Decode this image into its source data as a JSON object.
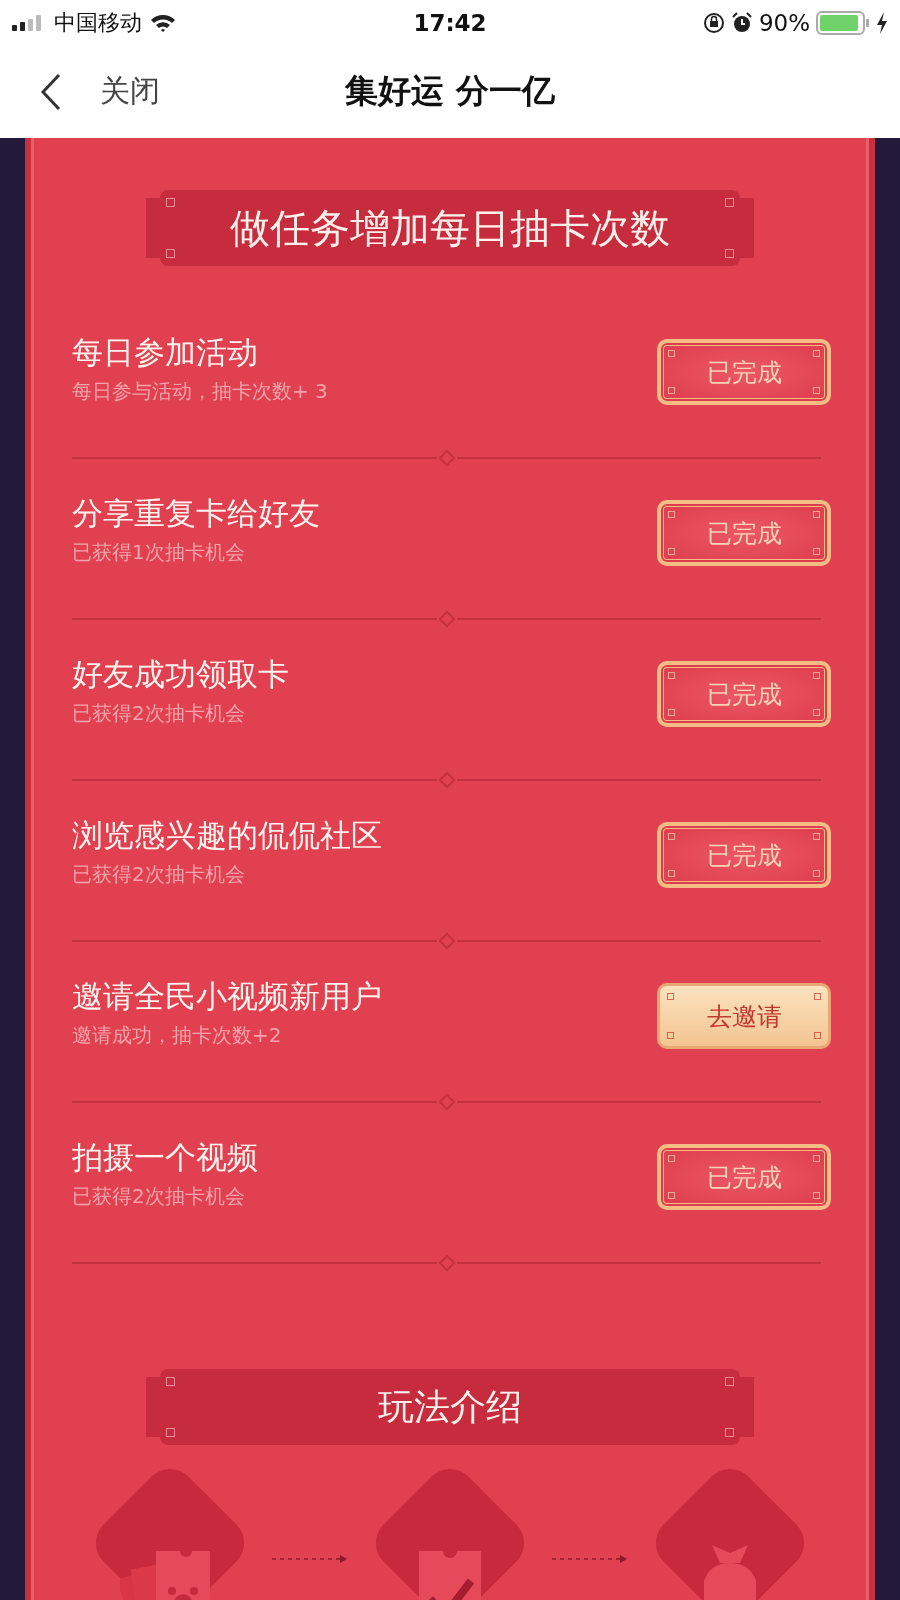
{
  "status_bar": {
    "carrier": "中国移动",
    "time": "17:42",
    "battery": "90%"
  },
  "nav": {
    "back": "关闭",
    "title": "集好运 分一亿"
  },
  "tasks_banner": {
    "title": "做任务增加每日抽卡次数"
  },
  "tasks": [
    {
      "title": "每日参加活动",
      "subtitle": "每日参与活动，抽卡次数+ 3",
      "button": {
        "label": "已完成",
        "kind": "done"
      }
    },
    {
      "title": "分享重复卡给好友",
      "subtitle": "已获得1次抽卡机会",
      "button": {
        "label": "已完成",
        "kind": "done"
      }
    },
    {
      "title": "好友成功领取卡",
      "subtitle": "已获得2次抽卡机会",
      "button": {
        "label": "已完成",
        "kind": "done"
      }
    },
    {
      "title": "浏览感兴趣的侃侃社区",
      "subtitle": "已获得2次抽卡机会",
      "button": {
        "label": "已完成",
        "kind": "done"
      }
    },
    {
      "title": "邀请全民小视频新用户",
      "subtitle": "邀请成功，抽卡次数+2",
      "button": {
        "label": "去邀请",
        "kind": "action"
      }
    },
    {
      "title": "拍摄一个视频",
      "subtitle": "已获得2次抽卡机会",
      "button": {
        "label": "已完成",
        "kind": "done"
      }
    }
  ],
  "rules_banner": {
    "title": "玩法介绍"
  },
  "steps": [
    {
      "kind": "cards"
    },
    {
      "kind": "check"
    },
    {
      "kind": "bag"
    }
  ]
}
